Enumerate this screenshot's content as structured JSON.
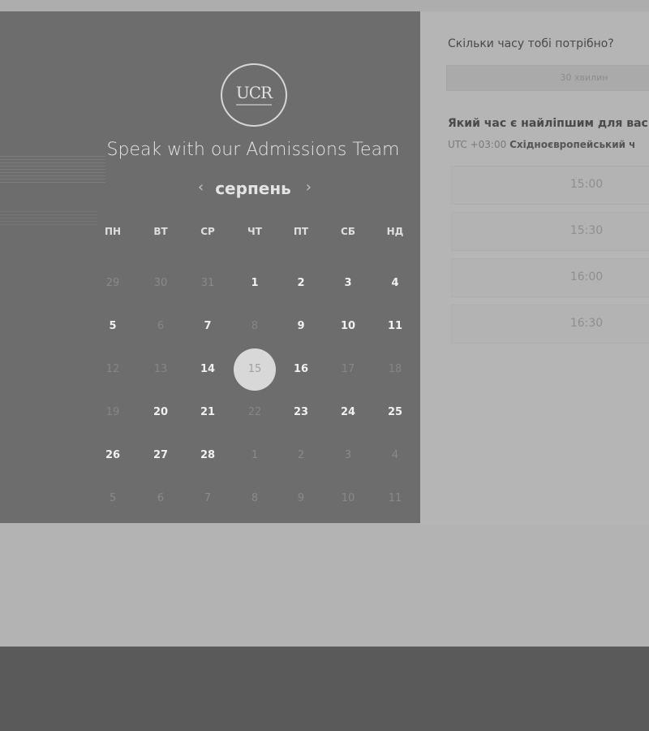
{
  "calendar": {
    "logo_text": "UCR",
    "title": "Speak with our Admissions Team",
    "month": "серпень",
    "prev_arrow": "‹",
    "next_arrow": "›",
    "weekdays": [
      "ПН",
      "ВТ",
      "СР",
      "ЧТ",
      "ПТ",
      "СБ",
      "НД"
    ],
    "weeks": [
      [
        {
          "d": "29",
          "s": "muted"
        },
        {
          "d": "30",
          "s": "muted"
        },
        {
          "d": "31",
          "s": "muted"
        },
        {
          "d": "1",
          "s": "available"
        },
        {
          "d": "2",
          "s": "available"
        },
        {
          "d": "3",
          "s": "available"
        },
        {
          "d": "4",
          "s": "available"
        }
      ],
      [
        {
          "d": "5",
          "s": "available"
        },
        {
          "d": "6",
          "s": "unavailable"
        },
        {
          "d": "7",
          "s": "available"
        },
        {
          "d": "8",
          "s": "unavailable"
        },
        {
          "d": "9",
          "s": "available"
        },
        {
          "d": "10",
          "s": "available"
        },
        {
          "d": "11",
          "s": "available"
        }
      ],
      [
        {
          "d": "12",
          "s": "unavailable"
        },
        {
          "d": "13",
          "s": "unavailable"
        },
        {
          "d": "14",
          "s": "available"
        },
        {
          "d": "15",
          "s": "selected"
        },
        {
          "d": "16",
          "s": "available"
        },
        {
          "d": "17",
          "s": "unavailable"
        },
        {
          "d": "18",
          "s": "unavailable"
        }
      ],
      [
        {
          "d": "19",
          "s": "unavailable"
        },
        {
          "d": "20",
          "s": "available"
        },
        {
          "d": "21",
          "s": "available"
        },
        {
          "d": "22",
          "s": "unavailable"
        },
        {
          "d": "23",
          "s": "available"
        },
        {
          "d": "24",
          "s": "available"
        },
        {
          "d": "25",
          "s": "available"
        }
      ],
      [
        {
          "d": "26",
          "s": "available"
        },
        {
          "d": "27",
          "s": "available"
        },
        {
          "d": "28",
          "s": "available"
        },
        {
          "d": "1",
          "s": "muted"
        },
        {
          "d": "2",
          "s": "muted"
        },
        {
          "d": "3",
          "s": "muted"
        },
        {
          "d": "4",
          "s": "muted"
        }
      ],
      [
        {
          "d": "5",
          "s": "muted"
        },
        {
          "d": "6",
          "s": "muted"
        },
        {
          "d": "7",
          "s": "muted"
        },
        {
          "d": "8",
          "s": "muted"
        },
        {
          "d": "9",
          "s": "muted"
        },
        {
          "d": "10",
          "s": "muted"
        },
        {
          "d": "11",
          "s": "muted"
        }
      ]
    ]
  },
  "booking": {
    "duration_question": "Скільки часу тобі потрібно?",
    "duration_value": "30 хвилин",
    "time_question": "Який час є найліпшим для вас",
    "timezone_offset": "UTC +03:00",
    "timezone_name": "Східноєвропейський ч",
    "slots": [
      "15:00",
      "15:30",
      "16:00",
      "16:30"
    ]
  }
}
